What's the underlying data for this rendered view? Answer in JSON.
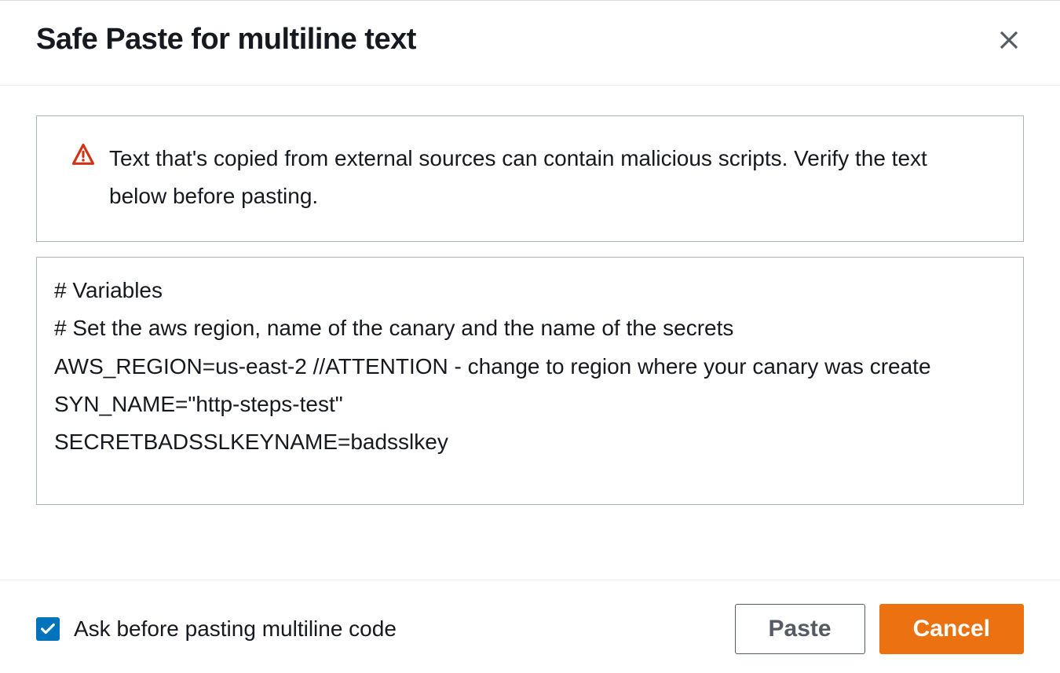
{
  "modal": {
    "title": "Safe Paste for multiline text",
    "alert_text": "Text that's copied from external sources can contain malicious scripts. Verify the text below before pasting.",
    "textarea_content": "# Variables\n# Set the aws region, name of the canary and the name of the secrets\nAWS_REGION=us-east-2 //ATTENTION - change to region where your canary was create\nSYN_NAME=\"http-steps-test\"\nSECRETBADSSLKEYNAME=badsslkey",
    "checkbox_label": "Ask before pasting multiline code",
    "checkbox_checked": true,
    "paste_button_label": "Paste",
    "cancel_button_label": "Cancel"
  }
}
